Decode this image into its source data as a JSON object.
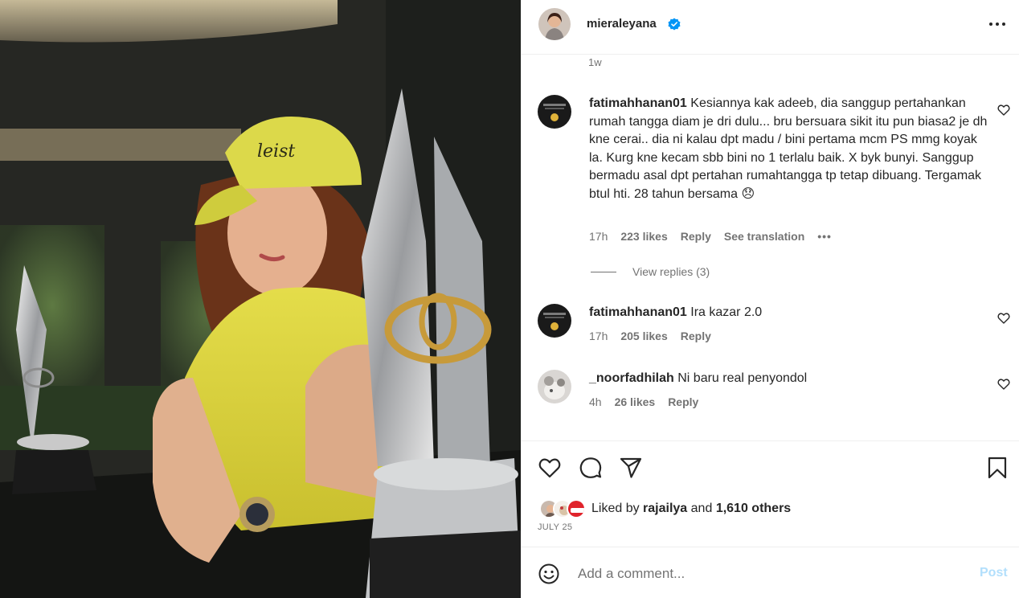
{
  "post": {
    "author": "mieraleyana",
    "verified": true,
    "time_ago": "1w",
    "date": "JULY 25",
    "liked_by_prefix": "Liked by",
    "liked_by_user": "rajailya",
    "liked_by_and": "and",
    "liked_by_others": "1,610 others"
  },
  "comments": [
    {
      "user": "fatimahhanan01",
      "text": "Kesiannya kak adeeb, dia sanggup pertahankan rumah tangga diam je dri dulu... bru bersuara sikit itu pun biasa2 je dh kne cerai.. dia ni kalau dpt madu / bini pertama mcm PS mmg koyak la. Kurg kne kecam sbb bini no 1 terlalu baik. X byk bunyi. Sanggup bermadu asal dpt pertahan rumahtangga tp tetap dibuang. Tergamak btul hti. 28 tahun bersama 😞",
      "time": "17h",
      "likes": "223 likes",
      "reply": "Reply",
      "translation": "See translation",
      "more": "•••",
      "view_replies": "View replies (3)"
    },
    {
      "user": "fatimahhanan01",
      "text": "Ira kazar 2.0",
      "time": "17h",
      "likes": "205 likes",
      "reply": "Reply"
    },
    {
      "user": "_noorfadhilah",
      "text": "Ni baru real penyondol",
      "time": "4h",
      "likes": "26 likes",
      "reply": "Reply"
    }
  ],
  "composer": {
    "placeholder": "Add a comment...",
    "post_label": "Post"
  },
  "icons": {
    "like": "heart-icon",
    "comment": "comment-icon",
    "share": "send-icon",
    "save": "bookmark-icon",
    "emoji": "emoji-icon",
    "more": "more-icon",
    "verified": "verified-badge-icon"
  },
  "colors": {
    "verified": "#0095f6",
    "post_button_disabled": "#b2dffc",
    "secondary_text": "#737373"
  }
}
